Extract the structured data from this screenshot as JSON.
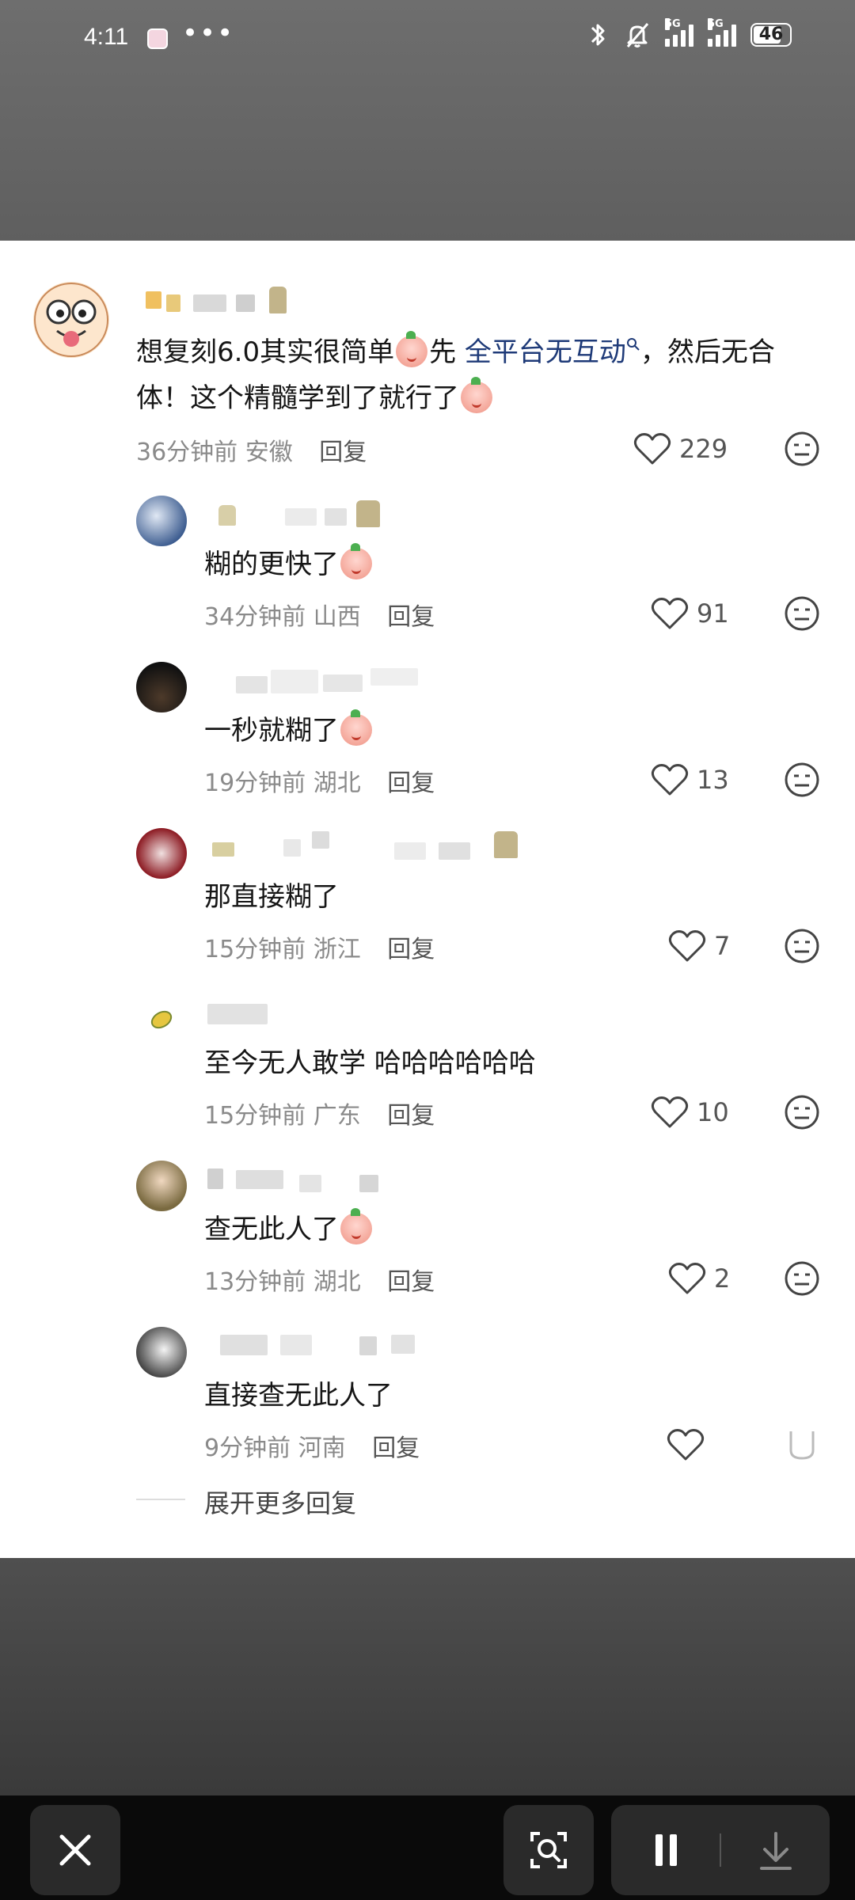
{
  "status_bar": {
    "time": "4:11",
    "dots": "•••",
    "signal1_tag": "5G",
    "signal2_tag": "5G",
    "battery": "46"
  },
  "comment": {
    "text_before_emoji": "想复刻6.0其实很简单",
    "text_after_emoji": "先 ",
    "link_text": "全平台无互动",
    "text_after_link": "，然后无合体！这个精髓学到了就行了",
    "time": "36分钟前",
    "location": "安徽",
    "reply_label": "回复",
    "likes": "229"
  },
  "replies": [
    {
      "text": "糊的更快了",
      "time": "34分钟前",
      "location": "山西",
      "reply_label": "回复",
      "likes": "91"
    },
    {
      "text": "一秒就糊了",
      "time": "19分钟前",
      "location": "湖北",
      "reply_label": "回复",
      "likes": "13"
    },
    {
      "text": "那直接糊了",
      "time": "15分钟前",
      "location": "浙江",
      "reply_label": "回复",
      "likes": "7"
    },
    {
      "text": "至今无人敢学 哈哈哈哈哈哈",
      "time": "15分钟前",
      "location": "广东",
      "reply_label": "回复",
      "likes": "10"
    },
    {
      "text": "查无此人了",
      "time": "13分钟前",
      "location": "湖北",
      "reply_label": "回复",
      "likes": "2"
    },
    {
      "text": "直接查无此人了",
      "time": "9分钟前",
      "location": "河南",
      "reply_label": "回复",
      "likes": ""
    }
  ],
  "expand_more_label": "展开更多回复",
  "icons": {
    "like": "heart-outline-icon",
    "dislike": "meh-face-icon",
    "close": "close-x-icon",
    "lens": "image-search-icon",
    "pause": "pause-icon",
    "download": "download-icon"
  },
  "colors": {
    "link": "#1e3a78",
    "meta": "#8a8a8a",
    "card": "#ffffff"
  }
}
